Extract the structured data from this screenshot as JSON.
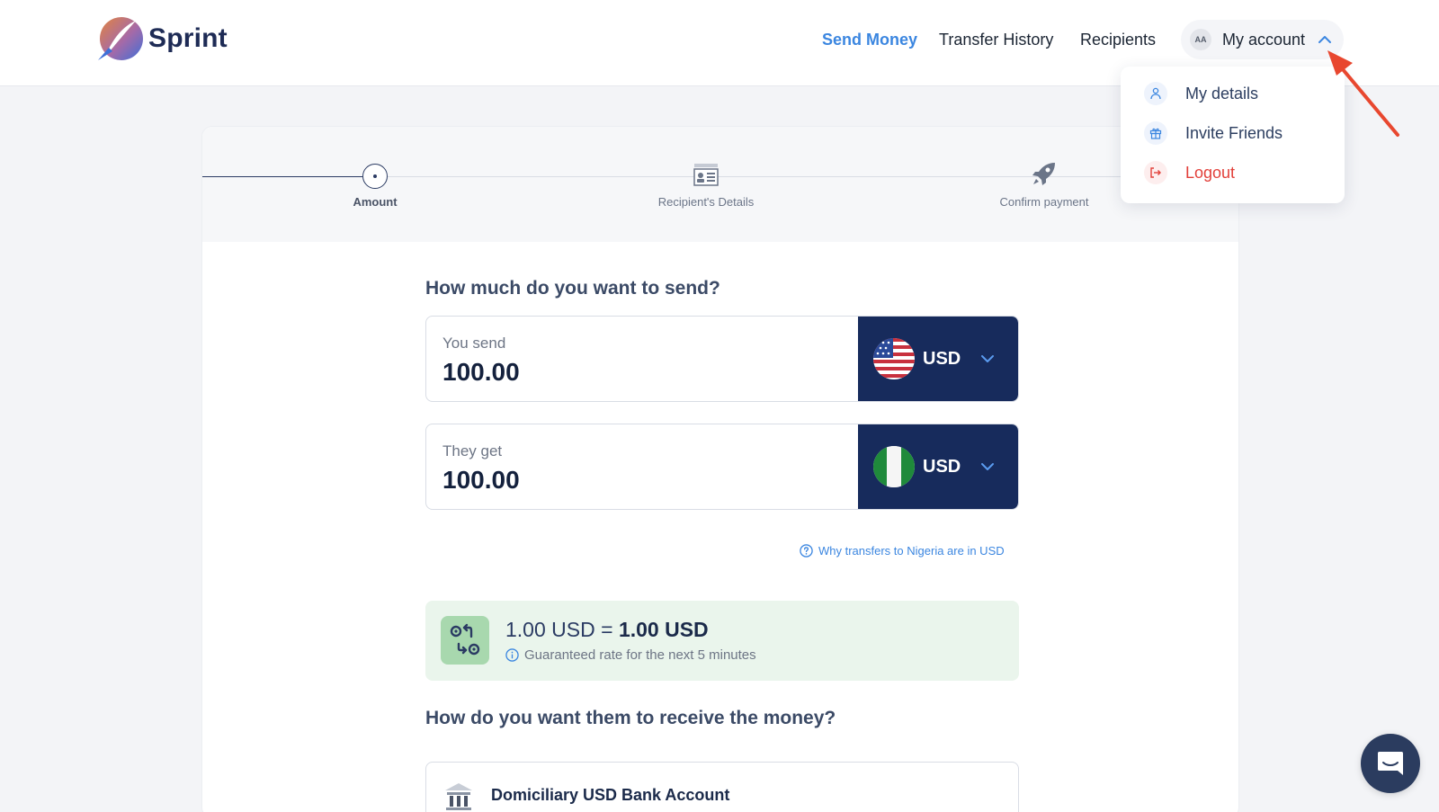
{
  "header": {
    "brand": "Sprint",
    "nav": {
      "send_money": "Send Money",
      "transfer_history": "Transfer History",
      "recipients": "Recipients"
    },
    "account": {
      "initials": "AA",
      "label": "My account"
    }
  },
  "account_menu": {
    "items": [
      {
        "label": "My details",
        "icon": "user-icon"
      },
      {
        "label": "Invite Friends",
        "icon": "gift-icon"
      },
      {
        "label": "Logout",
        "icon": "logout-icon"
      }
    ]
  },
  "stepper": {
    "steps": [
      {
        "label": "Amount",
        "state": "active"
      },
      {
        "label": "Recipient's Details",
        "state": "pending"
      },
      {
        "label": "Confirm payment",
        "state": "pending"
      }
    ]
  },
  "amount": {
    "title": "How much do you want to send?",
    "send": {
      "label": "You send",
      "value": "100.00",
      "currency": "USD",
      "flag": "us-flag"
    },
    "receive": {
      "label": "They get",
      "value": "100.00",
      "currency": "USD",
      "flag": "nigeria-flag"
    },
    "why_link": "Why transfers to Nigeria are in USD"
  },
  "rate": {
    "lhs": "1.00 USD =",
    "rhs": "1.00 USD",
    "note": "Guaranteed rate for the next 5 minutes"
  },
  "delivery": {
    "title": "How do you want them to receive the money?",
    "option_label": "Domiciliary USD Bank Account"
  },
  "colors": {
    "accent": "#3b86e0",
    "navy": "#172b5c",
    "logout": "#e2403a",
    "rate_bg": "#eaf5ec",
    "annotation": "#e8472f"
  }
}
